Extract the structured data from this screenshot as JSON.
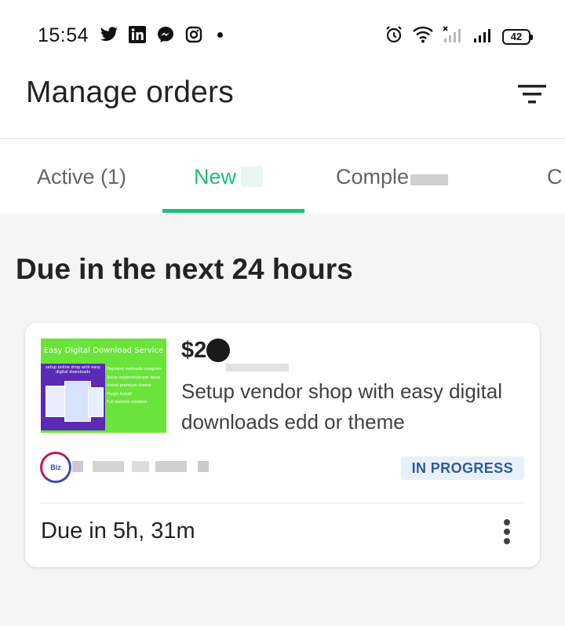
{
  "status_bar": {
    "time": "15:54",
    "app_icons": [
      "twitter-icon",
      "linkedin-icon",
      "messenger-icon",
      "instagram-icon",
      "notification-dot-icon"
    ],
    "system_icons": [
      "alarm-icon",
      "wifi-icon",
      "no-signal-icon",
      "signal-icon"
    ],
    "battery_level": "42"
  },
  "header": {
    "title": "Manage orders",
    "filter_icon": "filter-icon"
  },
  "tabs": [
    {
      "label": "Active (1)",
      "active": false
    },
    {
      "label": "New",
      "active": true
    },
    {
      "label": "Comple",
      "active": false
    },
    {
      "label": "C",
      "active": false
    }
  ],
  "section": {
    "title": "Due in the next 24 hours"
  },
  "order": {
    "thumbnail": {
      "title": "Easy Digital Download Service",
      "panel_text": "setup online shop with easy digital downloads",
      "features": [
        "Payment methods integrate",
        "Solve responsiveness issue",
        "Install premium theme",
        "Plugin Install",
        "Full website creation"
      ]
    },
    "price": "$2",
    "description": "Setup vendor shop with easy digital downloads edd or theme",
    "buyer_avatar_text": "Biz",
    "status": "IN PROGRESS",
    "due": "Due in 5h, 31m",
    "more_icon": "more-vertical-icon"
  },
  "colors": {
    "accent": "#1dbf73",
    "badge_bg": "#e8f0fb",
    "badge_text": "#2e5a9c",
    "thumbnail_bg": "#6ae43a"
  }
}
